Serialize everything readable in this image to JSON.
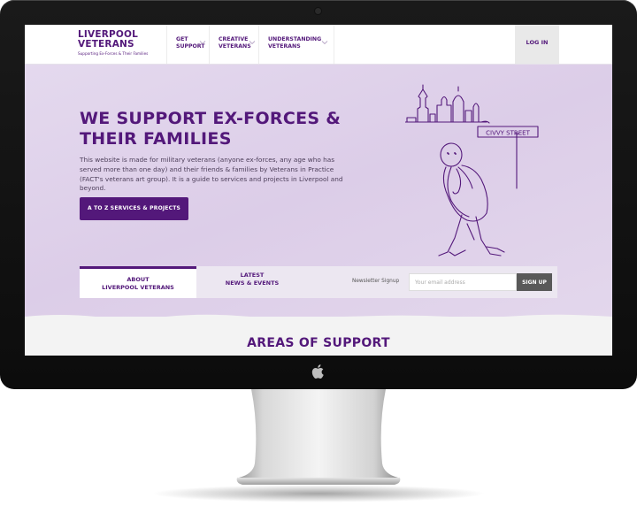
{
  "logo": {
    "line1": "LIVERPOOL",
    "line2": "VETERANS",
    "tagline": "Supporting Ex-Forces & Their Families"
  },
  "nav": {
    "items": [
      {
        "label": "GET\nSUPPORT"
      },
      {
        "label": "CREATIVE\nVETERANS"
      },
      {
        "label": "UNDERSTANDING\nVETERANS"
      }
    ],
    "login_label": "LOG IN"
  },
  "hero": {
    "title": "WE SUPPORT EX-FORCES & THEIR FAMILIES",
    "text": "This website is made for military veterans (anyone ex-forces, any age who has served more than one day) and their friends & families by Veterans in Practice (FACT's veterans art group). It is a guide to services and projects in Liverpool and beyond.",
    "cta_label": "A TO Z SERVICES & PROJECTS",
    "sign_text": "CIVVY STREET"
  },
  "tabs": {
    "about_label": "ABOUT\nLIVERPOOL VETERANS",
    "latest_label": "LATEST\nNEWS & EVENTS"
  },
  "newsletter": {
    "label": "Newsletter Signup",
    "placeholder": "Your email address",
    "button_label": "SIGN UP"
  },
  "areas": {
    "title": "AREAS OF SUPPORT"
  },
  "colors": {
    "brand_purple": "#53187a",
    "hero_bg": "#dccde8",
    "signup_button": "#595959"
  }
}
